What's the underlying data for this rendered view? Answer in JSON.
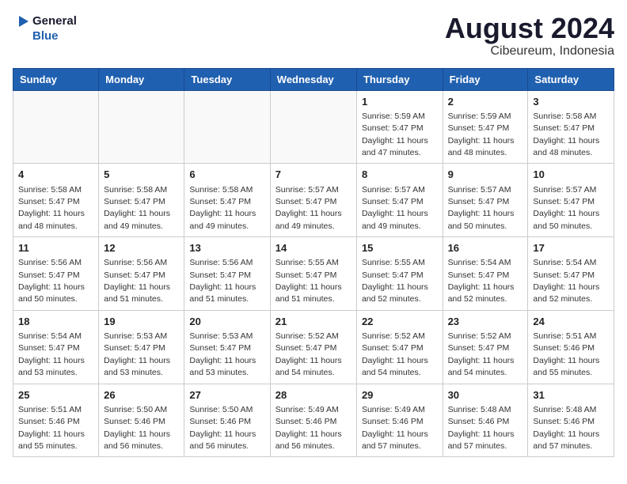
{
  "header": {
    "logo_line1": "General",
    "logo_line2": "Blue",
    "month_year": "August 2024",
    "location": "Cibeureum, Indonesia"
  },
  "weekdays": [
    "Sunday",
    "Monday",
    "Tuesday",
    "Wednesday",
    "Thursday",
    "Friday",
    "Saturday"
  ],
  "weeks": [
    [
      {
        "day": "",
        "info": ""
      },
      {
        "day": "",
        "info": ""
      },
      {
        "day": "",
        "info": ""
      },
      {
        "day": "",
        "info": ""
      },
      {
        "day": "1",
        "info": "Sunrise: 5:59 AM\nSunset: 5:47 PM\nDaylight: 11 hours and 47 minutes."
      },
      {
        "day": "2",
        "info": "Sunrise: 5:59 AM\nSunset: 5:47 PM\nDaylight: 11 hours and 48 minutes."
      },
      {
        "day": "3",
        "info": "Sunrise: 5:58 AM\nSunset: 5:47 PM\nDaylight: 11 hours and 48 minutes."
      }
    ],
    [
      {
        "day": "4",
        "info": "Sunrise: 5:58 AM\nSunset: 5:47 PM\nDaylight: 11 hours and 48 minutes."
      },
      {
        "day": "5",
        "info": "Sunrise: 5:58 AM\nSunset: 5:47 PM\nDaylight: 11 hours and 49 minutes."
      },
      {
        "day": "6",
        "info": "Sunrise: 5:58 AM\nSunset: 5:47 PM\nDaylight: 11 hours and 49 minutes."
      },
      {
        "day": "7",
        "info": "Sunrise: 5:57 AM\nSunset: 5:47 PM\nDaylight: 11 hours and 49 minutes."
      },
      {
        "day": "8",
        "info": "Sunrise: 5:57 AM\nSunset: 5:47 PM\nDaylight: 11 hours and 49 minutes."
      },
      {
        "day": "9",
        "info": "Sunrise: 5:57 AM\nSunset: 5:47 PM\nDaylight: 11 hours and 50 minutes."
      },
      {
        "day": "10",
        "info": "Sunrise: 5:57 AM\nSunset: 5:47 PM\nDaylight: 11 hours and 50 minutes."
      }
    ],
    [
      {
        "day": "11",
        "info": "Sunrise: 5:56 AM\nSunset: 5:47 PM\nDaylight: 11 hours and 50 minutes."
      },
      {
        "day": "12",
        "info": "Sunrise: 5:56 AM\nSunset: 5:47 PM\nDaylight: 11 hours and 51 minutes."
      },
      {
        "day": "13",
        "info": "Sunrise: 5:56 AM\nSunset: 5:47 PM\nDaylight: 11 hours and 51 minutes."
      },
      {
        "day": "14",
        "info": "Sunrise: 5:55 AM\nSunset: 5:47 PM\nDaylight: 11 hours and 51 minutes."
      },
      {
        "day": "15",
        "info": "Sunrise: 5:55 AM\nSunset: 5:47 PM\nDaylight: 11 hours and 52 minutes."
      },
      {
        "day": "16",
        "info": "Sunrise: 5:54 AM\nSunset: 5:47 PM\nDaylight: 11 hours and 52 minutes."
      },
      {
        "day": "17",
        "info": "Sunrise: 5:54 AM\nSunset: 5:47 PM\nDaylight: 11 hours and 52 minutes."
      }
    ],
    [
      {
        "day": "18",
        "info": "Sunrise: 5:54 AM\nSunset: 5:47 PM\nDaylight: 11 hours and 53 minutes."
      },
      {
        "day": "19",
        "info": "Sunrise: 5:53 AM\nSunset: 5:47 PM\nDaylight: 11 hours and 53 minutes."
      },
      {
        "day": "20",
        "info": "Sunrise: 5:53 AM\nSunset: 5:47 PM\nDaylight: 11 hours and 53 minutes."
      },
      {
        "day": "21",
        "info": "Sunrise: 5:52 AM\nSunset: 5:47 PM\nDaylight: 11 hours and 54 minutes."
      },
      {
        "day": "22",
        "info": "Sunrise: 5:52 AM\nSunset: 5:47 PM\nDaylight: 11 hours and 54 minutes."
      },
      {
        "day": "23",
        "info": "Sunrise: 5:52 AM\nSunset: 5:47 PM\nDaylight: 11 hours and 54 minutes."
      },
      {
        "day": "24",
        "info": "Sunrise: 5:51 AM\nSunset: 5:46 PM\nDaylight: 11 hours and 55 minutes."
      }
    ],
    [
      {
        "day": "25",
        "info": "Sunrise: 5:51 AM\nSunset: 5:46 PM\nDaylight: 11 hours and 55 minutes."
      },
      {
        "day": "26",
        "info": "Sunrise: 5:50 AM\nSunset: 5:46 PM\nDaylight: 11 hours and 56 minutes."
      },
      {
        "day": "27",
        "info": "Sunrise: 5:50 AM\nSunset: 5:46 PM\nDaylight: 11 hours and 56 minutes."
      },
      {
        "day": "28",
        "info": "Sunrise: 5:49 AM\nSunset: 5:46 PM\nDaylight: 11 hours and 56 minutes."
      },
      {
        "day": "29",
        "info": "Sunrise: 5:49 AM\nSunset: 5:46 PM\nDaylight: 11 hours and 57 minutes."
      },
      {
        "day": "30",
        "info": "Sunrise: 5:48 AM\nSunset: 5:46 PM\nDaylight: 11 hours and 57 minutes."
      },
      {
        "day": "31",
        "info": "Sunrise: 5:48 AM\nSunset: 5:46 PM\nDaylight: 11 hours and 57 minutes."
      }
    ]
  ]
}
